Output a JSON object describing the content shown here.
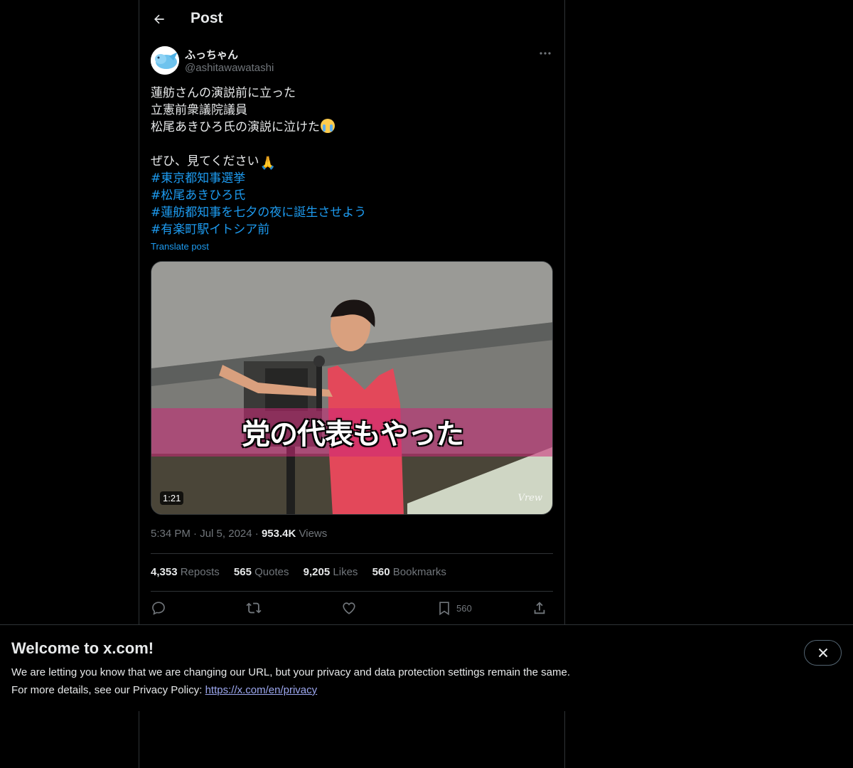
{
  "header": {
    "title": "Post"
  },
  "author": {
    "display_name": "ふっちゃん",
    "handle": "@ashitawawatashi"
  },
  "post": {
    "lines": [
      "蓮舫さんの演説前に立った",
      "立憲前衆議院議員",
      "松尾あきひろ氏の演説に泣けた"
    ],
    "line4": "ぜひ、見てください",
    "hashtags": [
      "#東京都知事選挙",
      "#松尾あきひろ氏",
      "#蓮舫都知事を七夕の夜に誕生させよう",
      "#有楽町駅イトシア前"
    ],
    "emojis": [
      "loudly-crying-face",
      "folded-hands"
    ],
    "translate": "Translate post"
  },
  "media": {
    "caption": "党の代表もやった",
    "duration": "1:21",
    "watermark": "Vrew"
  },
  "meta": {
    "time": "5:34 PM",
    "dot1": "·",
    "date": "Jul 5, 2024",
    "dot2": "·",
    "views_count": "953.4K",
    "views_label": "Views"
  },
  "stats": {
    "reposts_count": "4,353",
    "reposts_label": "Reposts",
    "quotes_count": "565",
    "quotes_label": "Quotes",
    "likes_count": "9,205",
    "likes_label": "Likes",
    "bookmarks_count": "560",
    "bookmarks_label": "Bookmarks"
  },
  "actions": {
    "bookmark_count": "560"
  },
  "banner": {
    "title": "Welcome to x.com!",
    "line1": "We are letting you know that we are changing our URL, but your privacy and data protection settings remain the same.",
    "line2_prefix": "For more details, see our Privacy Policy: ",
    "link": "https://x.com/en/privacy"
  },
  "colors": {
    "accent": "#1d9bf0",
    "background": "#000000",
    "text": "#e7e9ea",
    "muted": "#71767b",
    "border": "#2f3336"
  }
}
